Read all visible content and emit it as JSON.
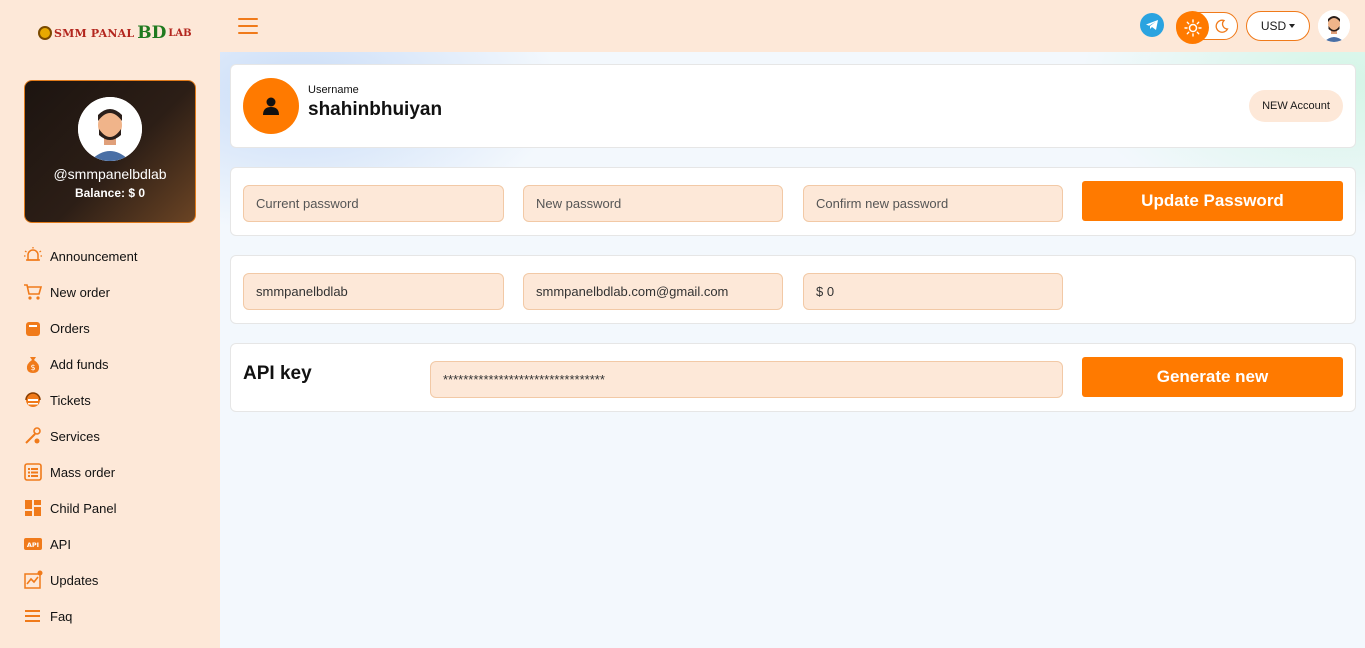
{
  "header": {
    "logo": {
      "part1": "SMM PANAL",
      "part2": "BD",
      "part3": "LAB"
    },
    "currency": "USD",
    "icons": {
      "menu": "hamburger-icon",
      "telegram": "telegram-icon",
      "light": "sun-icon",
      "dark": "moon-icon",
      "avatar": "user-avatar"
    }
  },
  "sidebar": {
    "profile": {
      "handle": "@smmpanelbdlab",
      "balance": "Balance: $ 0"
    },
    "items": [
      {
        "label": "Announcement",
        "icon": "bell-icon"
      },
      {
        "label": "New order",
        "icon": "cart-icon"
      },
      {
        "label": "Orders",
        "icon": "bag-icon"
      },
      {
        "label": "Add funds",
        "icon": "money-bag-icon"
      },
      {
        "label": "Tickets",
        "icon": "support-icon"
      },
      {
        "label": "Services",
        "icon": "tools-icon"
      },
      {
        "label": "Mass order",
        "icon": "list-icon"
      },
      {
        "label": "Child Panel",
        "icon": "grid-icon"
      },
      {
        "label": "API",
        "icon": "api-icon"
      },
      {
        "label": "Updates",
        "icon": "chart-icon"
      },
      {
        "label": "Faq",
        "icon": "faq-icon"
      }
    ]
  },
  "account": {
    "username_label": "Username",
    "username": "shahinbhuiyan",
    "new_account_label": "NEW Account"
  },
  "password": {
    "current_placeholder": "Current password",
    "new_placeholder": "New password",
    "confirm_placeholder": "Confirm new password",
    "update_label": "Update Password"
  },
  "info": {
    "username_value": "smmpanelbdlab",
    "email_value": "smmpanelbdlab.com@gmail.com",
    "balance_value": "$ 0"
  },
  "api": {
    "label": "API key",
    "key_value": "********************************",
    "generate_label": "Generate new"
  },
  "colors": {
    "accent": "#ff7a00",
    "sidebar_bg": "#fde8d8",
    "field_bg": "#fde8d8"
  }
}
